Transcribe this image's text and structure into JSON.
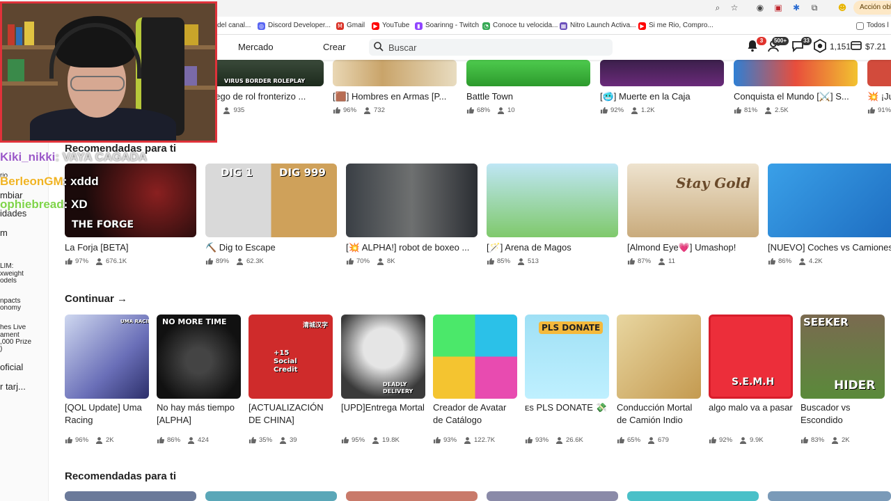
{
  "browser": {
    "action_pill": "Acción obli",
    "bookmarks": [
      {
        "label": "del canal...",
        "color": "#888888",
        "glyph": ""
      },
      {
        "label": "Discord Developer...",
        "color": "#5865f2",
        "glyph": "◎"
      },
      {
        "label": "Gmail",
        "color": "#d93025",
        "glyph": "M"
      },
      {
        "label": "YouTube",
        "color": "#ff0000",
        "glyph": "▶"
      },
      {
        "label": "Soarinng - Twitch",
        "color": "#9146ff",
        "glyph": "▮"
      },
      {
        "label": "Conoce tu velocida...",
        "color": "#34a853",
        "glyph": "◔"
      },
      {
        "label": "Nitro Launch Activa...",
        "color": "#6b4fbb",
        "glyph": "▦"
      },
      {
        "label": "Si me Rio, Compro...",
        "color": "#ff0000",
        "glyph": "▶"
      }
    ],
    "bookmarks_folder": "Todos l"
  },
  "header": {
    "nav": [
      "Mercado",
      "Crear"
    ],
    "search_placeholder": "Buscar",
    "notifications_count": "3",
    "friends_count": "500+",
    "messages_count": "33",
    "robux": "1,151",
    "balance": "$7.21"
  },
  "webcam": {
    "label": "Streamer webcam"
  },
  "chat": [
    {
      "user": "Kiki_nikki",
      "msg": ": VAYA CAGADA",
      "user_color": "#9b59c8",
      "msg_color": "#e6e6e6"
    },
    {
      "user": "BerleonGM",
      "msg": ": xddd",
      "user_color": "#f0b323",
      "msg_color": "#ffffff"
    },
    {
      "user": "ophiebread",
      "msg": ": XD",
      "user_color": "#7fd44a",
      "msg_color": "#ffffff"
    }
  ],
  "sidebar": {
    "items": [
      "rio",
      "mbiar",
      "idades",
      "m",
      "LIM:",
      "xweight",
      "odels",
      "npacts",
      "onomy",
      "hes Live",
      "ament",
      ",000 Prize",
      ")",
      "oficial",
      "r tarj..."
    ]
  },
  "sections": {
    "rec1": "Recomendadas para ti",
    "continue": "Continuar",
    "continue_arrow": "→",
    "rec2": "Recomendadas para ti"
  },
  "top_row": [
    {
      "title": "uego de rol fronterizo ...",
      "rating": "%",
      "players": "935",
      "banner": "VIRUS BORDER ROLEPLAY"
    },
    {
      "title": "[🟫] Hombres en Armas [P...",
      "rating": "96%",
      "players": "732"
    },
    {
      "title": "Battle Town",
      "rating": "68%",
      "players": "10"
    },
    {
      "title": "[🥶] Muerte en la Caja",
      "rating": "92%",
      "players": "1.2K"
    },
    {
      "title": "Conquista el Mundo [⚔️] S...",
      "rating": "81%",
      "players": "2.5K"
    },
    {
      "title": "💥 ¡Ju",
      "rating": "91%",
      "players": ""
    }
  ],
  "recommended": [
    {
      "title": "La Forja [BETA]",
      "rating": "97%",
      "players": "676.1K",
      "thumb_text": "THE FORGE"
    },
    {
      "title": "⛏️ Dig to Escape",
      "rating": "89%",
      "players": "62.3K",
      "thumb_text_a": "DIG 1",
      "thumb_text_b": "DIG 999"
    },
    {
      "title": "[💥 ALPHA!] robot de boxeo ...",
      "rating": "70%",
      "players": "8K"
    },
    {
      "title": "[🪄] Arena de Magos",
      "rating": "85%",
      "players": "513"
    },
    {
      "title": "[Almond Eye💗] Umashop!",
      "rating": "87%",
      "players": "11",
      "thumb_text": "Stay Gold"
    },
    {
      "title": "[NUEVO] Coches vs Camiones",
      "rating": "86%",
      "players": "4.2K"
    }
  ],
  "continue_row": [
    {
      "title": "[QOL Update] Uma Racing",
      "rating": "96%",
      "players": "2K",
      "thumb_text": "UMA RACING"
    },
    {
      "title": "No hay más tiempo [ALPHA]",
      "rating": "86%",
      "players": "424",
      "thumb_text": "NO MORE TIME"
    },
    {
      "title": "[ACTUALIZACIÓN DE CHINA]",
      "rating": "35%",
      "players": "39",
      "thumb_text": "+15 Social Credit",
      "thumb_text_b": "清城汉字"
    },
    {
      "title": "[UPD]Entrega Mortal",
      "rating": "95%",
      "players": "19.8K",
      "thumb_text": "DEADLY DELIVERY"
    },
    {
      "title": "Creador de Avatar de Catálogo",
      "rating": "93%",
      "players": "122.7K"
    },
    {
      "title": "ᴇs PLS DONATE 💸",
      "rating": "93%",
      "players": "26.6K",
      "thumb_text": "PLS DONATE"
    },
    {
      "title": "Conducción Mortal de Camión Indio",
      "rating": "65%",
      "players": "679"
    },
    {
      "title": "algo malo va a pasar",
      "rating": "92%",
      "players": "9.9K",
      "thumb_text": "S.E.M.H"
    },
    {
      "title": "Buscador vs Escondido",
      "rating": "83%",
      "players": "2K",
      "thumb_text": "SEEKER",
      "thumb_text_b": "HIDER"
    }
  ]
}
